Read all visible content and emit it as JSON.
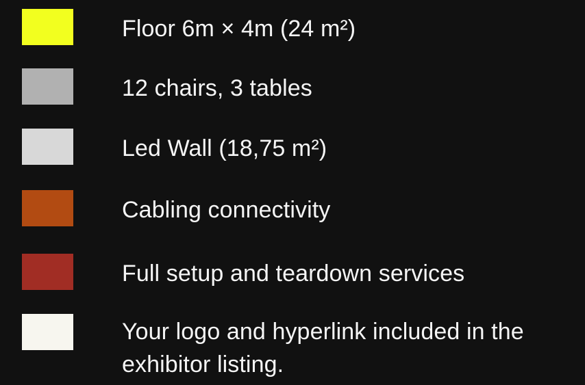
{
  "legend": {
    "items": [
      {
        "label": "Floor 6m × 4m (24 m²)",
        "color": "#f2ff1f"
      },
      {
        "label": "12 chairs, 3 tables",
        "color": "#b1b1b1"
      },
      {
        "label": "Led Wall (18,75 m²)",
        "color": "#d8d8d8"
      },
      {
        "label": "Cabling connectivity",
        "color": "#b24b12"
      },
      {
        "label": "Full setup and teardown services",
        "color": "#a12d24"
      },
      {
        "label": "Your logo and hyperlink included in the exhibitor listing.",
        "color": "#f7f6ef"
      }
    ]
  }
}
